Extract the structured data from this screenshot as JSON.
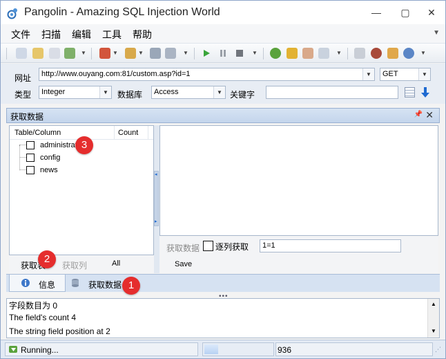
{
  "window": {
    "title": "Pangolin - Amazing SQL Injection World"
  },
  "menu": [
    "文件",
    "扫描",
    "编辑",
    "工具",
    "帮助"
  ],
  "toolbar_icons": [
    "search-icon",
    "document-icon",
    "list-icon",
    "save-icon",
    "report-icon",
    "plugin-icon",
    "wrench-icon",
    "database-icon",
    "play-icon",
    "pause-icon",
    "stop-icon",
    "check-icon",
    "key-icon",
    "user-icon",
    "find-icon",
    "home-icon",
    "bug-icon",
    "cube-icon",
    "info-icon"
  ],
  "url": {
    "label": "网址",
    "value": "http://www.ouyang.com:81/custom.asp?id=1",
    "method": "GET"
  },
  "filters": {
    "type_label": "类型",
    "type_value": "Integer",
    "db_label": "数据库",
    "db_value": "Access",
    "keyword_label": "关键字",
    "keyword_value": ""
  },
  "panel": {
    "title": "获取数据"
  },
  "tree": {
    "col_table": "Table/Column",
    "col_count": "Count",
    "items": [
      "administrat",
      "config",
      "news"
    ]
  },
  "left_actions": {
    "get": "获取表",
    "get_cols": "获取列",
    "all": "All"
  },
  "right_actions": {
    "get_data": "获取数据",
    "per_col_label": "逐列获取",
    "condition": "1=1",
    "save": "Save"
  },
  "tabs": [
    {
      "label": "信息"
    },
    {
      "label": "获取数据"
    }
  ],
  "log": [
    "字段数目为 0",
    "The field's count 4",
    "The string field position at 2"
  ],
  "status": {
    "text": "Running...",
    "progress": 0.2,
    "count": "936"
  },
  "badges": [
    "1",
    "2",
    "3"
  ]
}
